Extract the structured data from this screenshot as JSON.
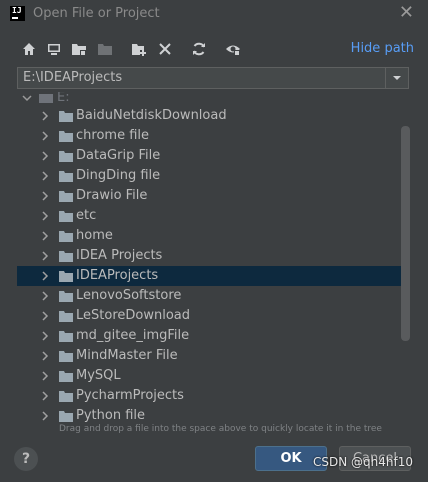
{
  "window": {
    "title": "Open File or Project",
    "logo_text": "IJ",
    "close_glyph": "✕"
  },
  "toolbar": {
    "icons": [
      "home-icon",
      "desktop-icon",
      "project-folder-icon",
      "module-folder-icon",
      "new-folder-icon",
      "delete-icon",
      "refresh-icon",
      "show-hidden-icon"
    ],
    "hide_path_label": "Hide path"
  },
  "path": {
    "value": "E:\\IDEAProjects"
  },
  "tree": {
    "root_label": "E:",
    "items": [
      {
        "label": "BaiduNetdiskDownload",
        "selected": false
      },
      {
        "label": "chrome file",
        "selected": false
      },
      {
        "label": "DataGrip File",
        "selected": false
      },
      {
        "label": "DingDing file",
        "selected": false
      },
      {
        "label": "Drawio File",
        "selected": false
      },
      {
        "label": "etc",
        "selected": false
      },
      {
        "label": "home",
        "selected": false
      },
      {
        "label": "IDEA Projects",
        "selected": false
      },
      {
        "label": "IDEAProjects",
        "selected": true
      },
      {
        "label": "LenovoSoftstore",
        "selected": false
      },
      {
        "label": "LeStoreDownload",
        "selected": false
      },
      {
        "label": "md_gitee_imgFile",
        "selected": false
      },
      {
        "label": "MindMaster File",
        "selected": false
      },
      {
        "label": "MySQL",
        "selected": false
      },
      {
        "label": "PycharmProjects",
        "selected": false
      },
      {
        "label": "Python file",
        "selected": false
      }
    ]
  },
  "hint": "Drag and drop a file into the space above to quickly locate it in the tree",
  "buttons": {
    "help": "?",
    "ok": "OK",
    "cancel": "Cancel"
  },
  "watermark": "CSDN @qh4hf10",
  "colors": {
    "background": "#3c3f41",
    "selection": "#0d293e",
    "link": "#589df6",
    "ok_button": "#365880",
    "folder": "#9aa7b0"
  }
}
